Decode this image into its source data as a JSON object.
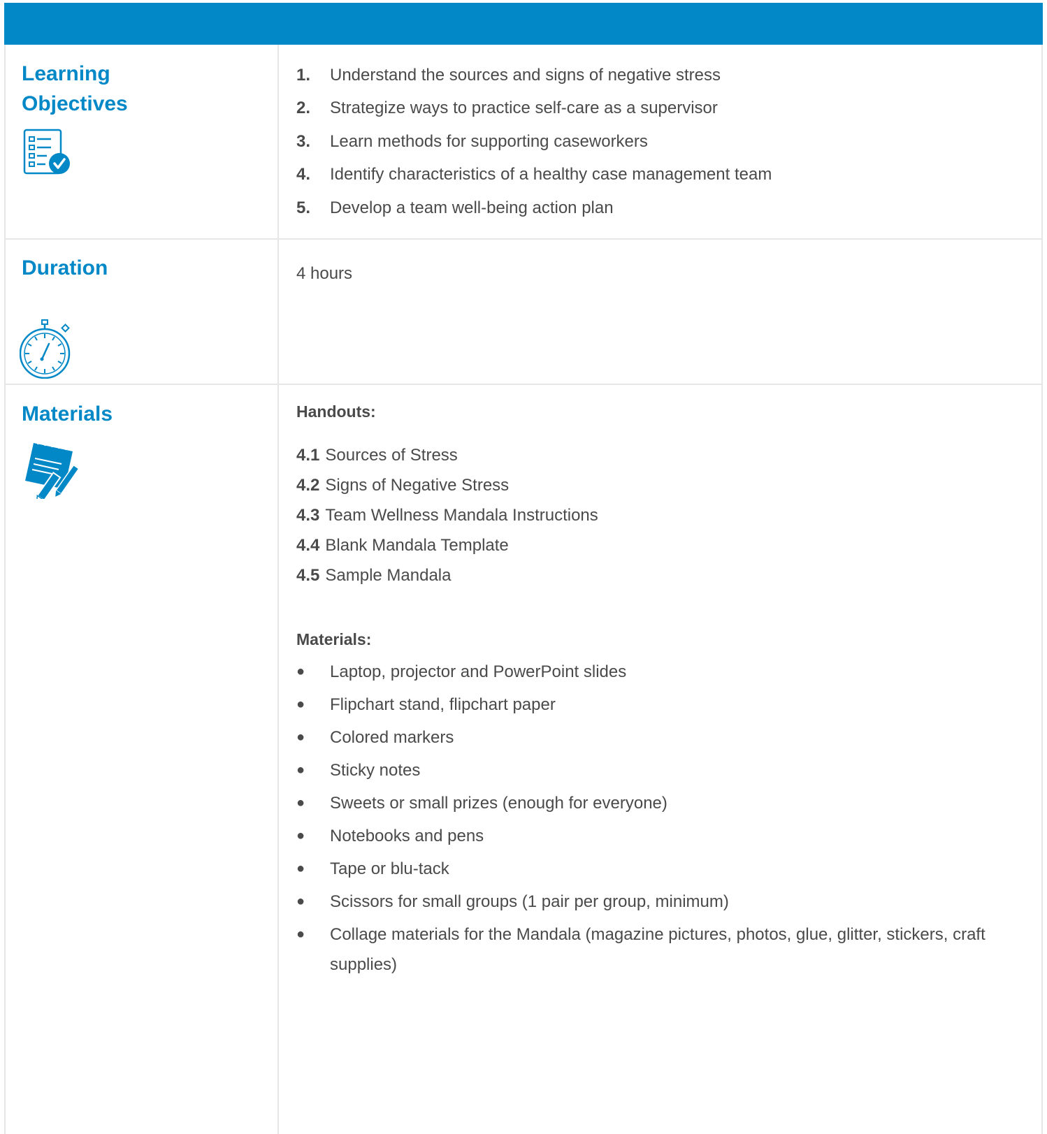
{
  "sections": {
    "objectives": {
      "title_line1": "Learning",
      "title_line2": "Objectives",
      "icon": "checklist-icon",
      "items": [
        {
          "num": "1.",
          "text": "Understand the sources and signs of negative stress"
        },
        {
          "num": "2.",
          "text": "Strategize ways to practice self-care as a supervisor"
        },
        {
          "num": "3.",
          "text": "Learn methods for supporting caseworkers"
        },
        {
          "num": "4.",
          "text": "Identify characteristics of a healthy case management team"
        },
        {
          "num": "5.",
          "text": "Develop a team well-being action plan"
        }
      ]
    },
    "duration": {
      "title": "Duration",
      "icon": "stopwatch-icon",
      "value": "4 hours"
    },
    "materials": {
      "title": "Materials",
      "icon": "notepad-pen-icon",
      "handouts_label": "Handouts:",
      "handouts": [
        {
          "code": "4.1",
          "text": "Sources of Stress"
        },
        {
          "code": "4.2",
          "text": "Signs of Negative Stress"
        },
        {
          "code": "4.3",
          "text": "Team Wellness Mandala Instructions"
        },
        {
          "code": "4.4",
          "text": "Blank Mandala Template"
        },
        {
          "code": "4.5",
          "text": "Sample Mandala"
        }
      ],
      "materials_label": "Materials:",
      "items": [
        "Laptop, projector and PowerPoint slides",
        "Flipchart stand, flipchart paper",
        "Colored markers",
        "Sticky notes",
        "Sweets or small prizes (enough for everyone)",
        "Notebooks and pens",
        "Tape or blu-tack",
        "Scissors for small groups (1 pair per group, minimum)",
        "Collage materials for the Mandala (magazine pictures, photos, glue, glitter, stickers, craft supplies)"
      ]
    }
  },
  "colors": {
    "accent": "#0288c7",
    "text": "#4a4a4a",
    "divider": "#e6e6e6"
  }
}
